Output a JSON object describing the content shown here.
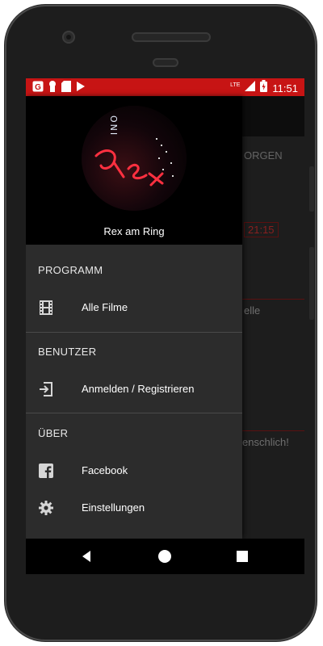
{
  "status_bar": {
    "time": "11:51",
    "network": "LTE",
    "icons_left": [
      "g-icon",
      "keyhole-icon",
      "sd-card-icon",
      "play-store-icon"
    ],
    "icons_right": [
      "signal-icon",
      "battery-charging-icon"
    ],
    "color": "#c71414"
  },
  "background_app": {
    "header_text": "ORGEN",
    "time_badge": "21:15",
    "text_1": "elle",
    "text_2": "enschlich!"
  },
  "drawer": {
    "header_title": "Rex am Ring",
    "logo_text_vertical": "INO",
    "logo_neon_text": "Rex",
    "sections": [
      {
        "title": "PROGRAMM",
        "items": [
          {
            "label": "Alle Filme",
            "icon": "film-strip-icon"
          }
        ]
      },
      {
        "title": "BENUTZER",
        "items": [
          {
            "label": "Anmelden / Registrieren",
            "icon": "login-icon"
          }
        ]
      },
      {
        "title": "ÜBER",
        "items": [
          {
            "label": "Facebook",
            "icon": "facebook-icon"
          },
          {
            "label": "Einstellungen",
            "icon": "gear-icon"
          }
        ]
      }
    ]
  },
  "nav_bar": {
    "buttons": [
      "back-icon",
      "home-icon",
      "recents-icon"
    ]
  }
}
